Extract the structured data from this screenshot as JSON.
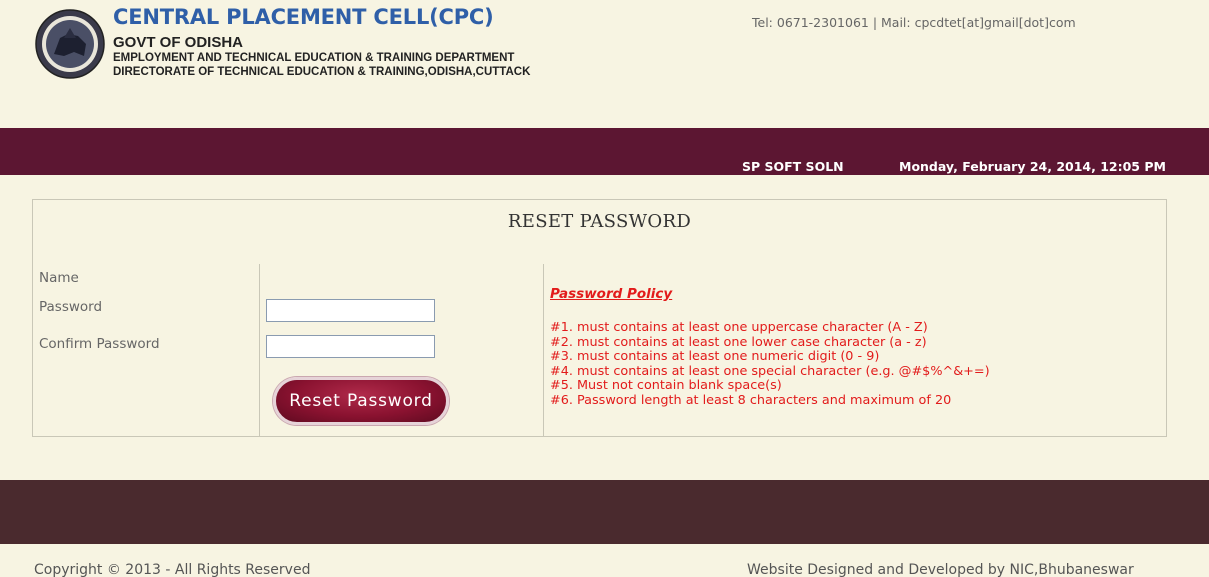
{
  "header": {
    "title": "CENTRAL PLACEMENT CELL(CPC)",
    "line1": "GOVT OF ODISHA",
    "line2": "EMPLOYMENT AND TECHNICAL EDUCATION & TRAINING DEPARTMENT",
    "line3": "DIRECTORATE OF TECHNICAL EDUCATION & TRAINING,ODISHA,CUTTACK",
    "contact": "Tel: 0671-2301061 | Mail: cpcdtet[at]gmail[dot]com",
    "logo_icon": "odisha-state-emblem-icon"
  },
  "topbar": {
    "org": "SP SOFT SOLN",
    "datetime": "Monday, February 24, 2014, 12:05 PM"
  },
  "form": {
    "title": "RESET PASSWORD",
    "name_label": "Name",
    "password_label": "Password",
    "confirm_label": "Confirm Password",
    "password_value": "",
    "confirm_value": "",
    "submit_label": "Reset Password"
  },
  "policy": {
    "title": "Password Policy",
    "rules": [
      "#1. must contains at least one uppercase character (A - Z)",
      "#2. must contains at least one lower case character (a - z)",
      "#3. must contains at least one numeric digit (0 - 9)",
      "#4. must contains at least one special character (e.g. @#$%^&+=)",
      "#5. Must not contain blank space(s)",
      "#6. Password length at least 8 characters and maximum of 20"
    ]
  },
  "footer": {
    "copyright": "Copyright © 2013 - All Rights Reserved",
    "credit": "Website Designed and Developed by NIC,Bhubaneswar"
  },
  "colors": {
    "page_bg": "#f7f4e2",
    "topbar": "#5c1632",
    "footer_band": "#4a2a2e",
    "title_blue": "#2f5fa8",
    "policy_red": "#e21b1b",
    "button": "#8a1230"
  }
}
